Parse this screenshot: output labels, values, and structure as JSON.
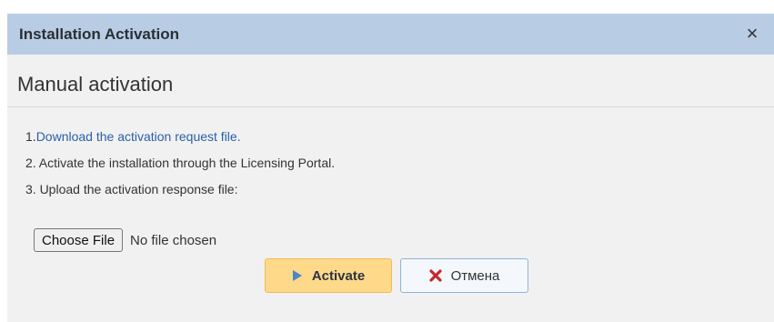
{
  "dialog": {
    "title": "Installation Activation",
    "close_glyph": "×"
  },
  "section": {
    "title": "Manual activation"
  },
  "steps": {
    "step1_prefix": "1. ",
    "step1_link": "Download the activation request file.",
    "step2": "2. Activate the installation through the Licensing Portal.",
    "step3": "3. Upload the activation response file:"
  },
  "file_input": {
    "button_label": "Choose File",
    "status": "No file chosen"
  },
  "buttons": {
    "activate_label": "Activate",
    "cancel_label": "Отмена"
  },
  "icons": {
    "activate": "play-triangle-icon",
    "cancel": "x-icon",
    "close": "close-icon"
  },
  "colors": {
    "titlebar": "#b8cde3",
    "link": "#2b5fa6",
    "activate_bg": "#ffd98a",
    "cancel_border": "#8fb3d9",
    "cancel_icon": "#c62828",
    "activate_icon": "#4a86c8"
  }
}
